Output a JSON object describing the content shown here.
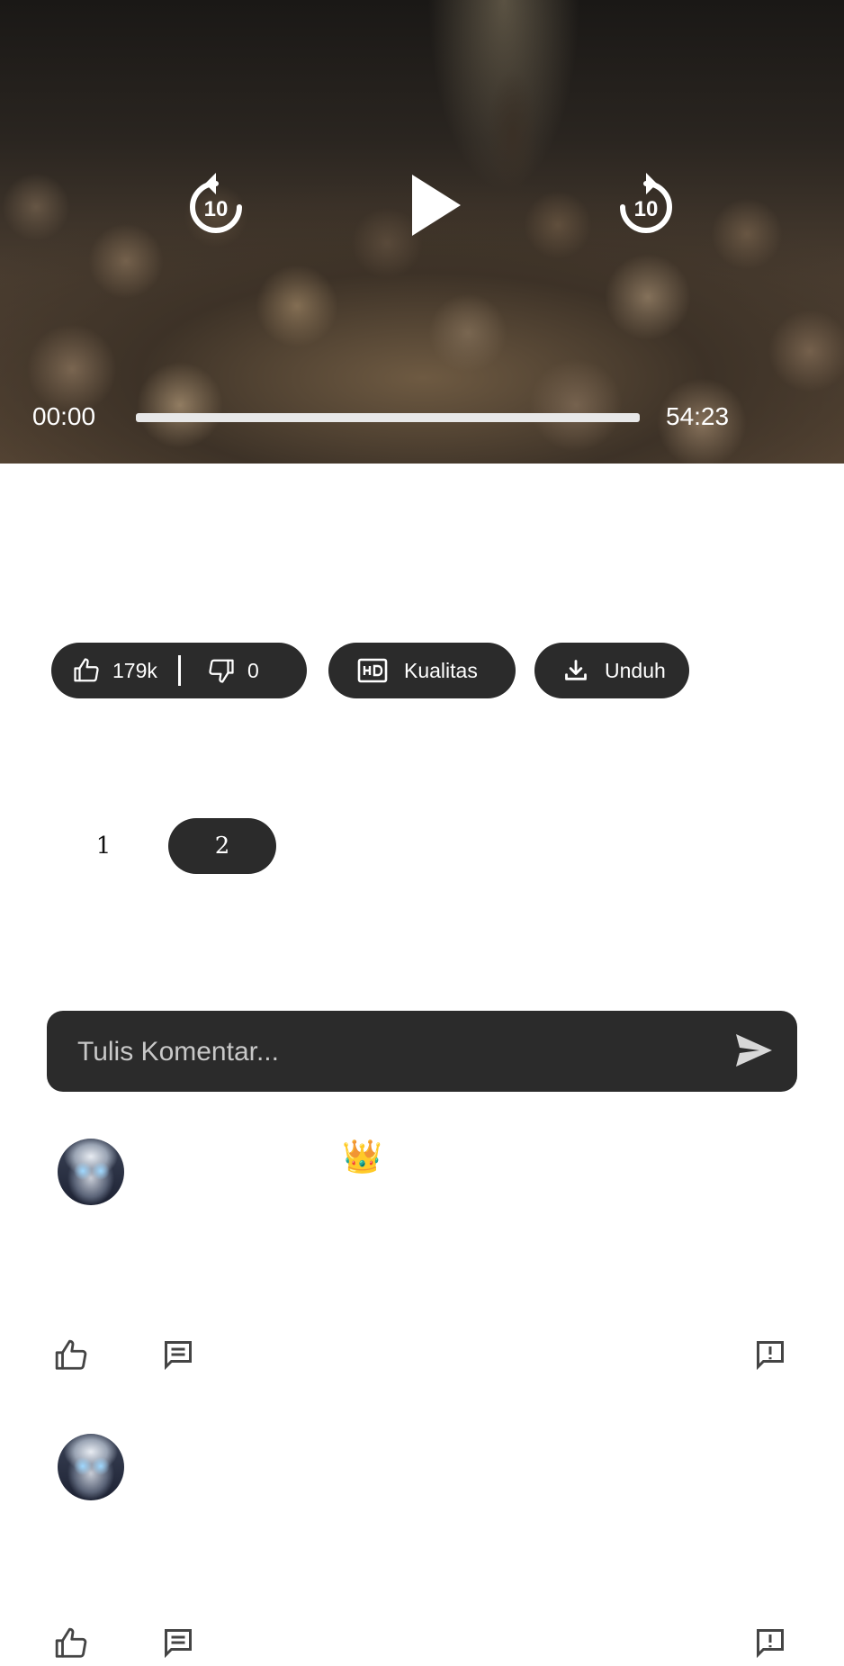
{
  "player": {
    "current_time": "00:00",
    "total_time": "54:23",
    "progress_percent": 0,
    "rewind_seconds": "10",
    "forward_seconds": "10"
  },
  "actions": {
    "likes": "179k",
    "dislikes": "0",
    "quality_label": "Kualitas",
    "download_label": "Unduh"
  },
  "pagination": {
    "pages": [
      "1",
      "2"
    ],
    "active": "2"
  },
  "comment_form": {
    "placeholder": "Tulis Komentar..."
  },
  "comments": [
    {
      "badge": "👑"
    },
    {
      "badge": ""
    }
  ],
  "icons": {
    "rewind": "replay-10-icon",
    "play": "play-icon",
    "forward": "forward-10-icon",
    "like": "thumb-up-icon",
    "dislike": "thumb-down-icon",
    "quality": "hd-icon",
    "download": "download-icon",
    "send": "send-icon",
    "reply": "comment-icon",
    "report": "report-icon"
  },
  "colors": {
    "pill_bg": "#2b2b2b",
    "text_on_dark": "#ffffff",
    "page_bg": "#ffffff"
  }
}
